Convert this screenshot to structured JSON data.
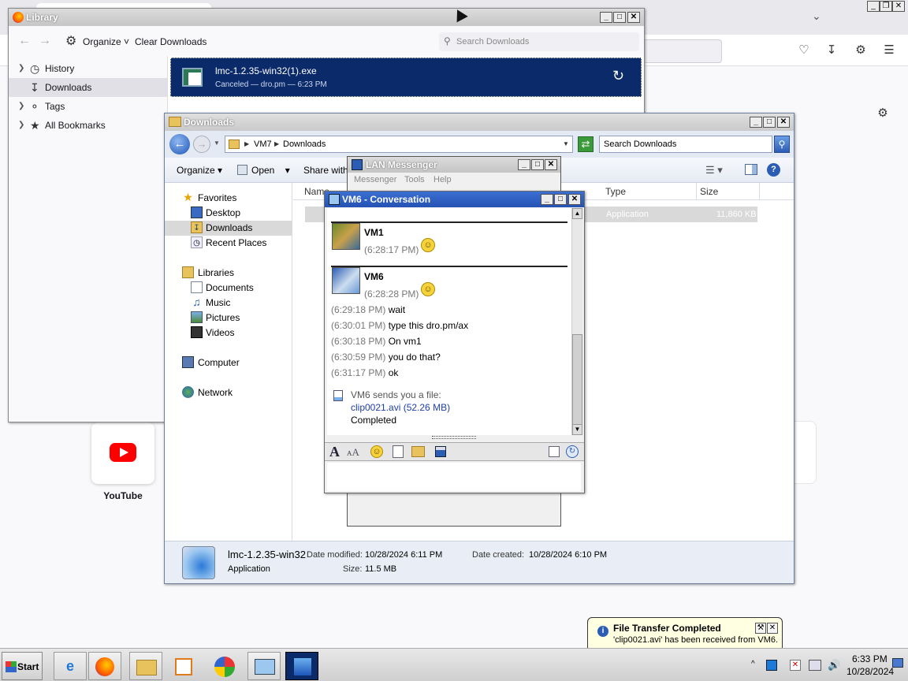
{
  "firefox": {
    "yt_label": "YouTube",
    "icons": [
      "pocket-icon",
      "download-icon",
      "extensions-icon",
      "menu-icon",
      "settings-icon"
    ]
  },
  "library": {
    "title": "Library",
    "organize": "Organize",
    "clear": "Clear Downloads",
    "search_placeholder": "Search Downloads",
    "sidebar": [
      {
        "label": "History",
        "icon": "clock-icon"
      },
      {
        "label": "Downloads",
        "icon": "download-icon"
      },
      {
        "label": "Tags",
        "icon": "tag-icon"
      },
      {
        "label": "All Bookmarks",
        "icon": "star-icon"
      }
    ],
    "download": {
      "name": "lmc-1.2.35-win32(1).exe",
      "status": "Canceled — dro.pm — 6:23 PM"
    }
  },
  "explorer": {
    "title": "Downloads",
    "breadcrumb": [
      "VM7",
      "Downloads"
    ],
    "search_placeholder": "Search Downloads",
    "cmd": {
      "organize": "Organize",
      "open": "Open",
      "share": "Share with"
    },
    "nav": {
      "favorites": "Favorites",
      "desktop": "Desktop",
      "downloads": "Downloads",
      "recent": "Recent Places",
      "libraries": "Libraries",
      "documents": "Documents",
      "music": "Music",
      "pictures": "Pictures",
      "videos": "Videos",
      "computer": "Computer",
      "network": "Network"
    },
    "columns": {
      "name": "Name",
      "type": "Type",
      "size": "Size"
    },
    "row": {
      "type": "Application",
      "size": "11,860 KB"
    },
    "details": {
      "name": "lmc-1.2.35-win32",
      "kind": "Application",
      "modified_label": "Date modified:",
      "modified": "10/28/2024 6:11 PM",
      "size_label": "Size:",
      "size": "11.5 MB",
      "created_label": "Date created:",
      "created": "10/28/2024 6:10 PM"
    }
  },
  "lan": {
    "title": "LAN Messenger",
    "menu": [
      "Messenger",
      "Tools",
      "Help"
    ]
  },
  "conversation": {
    "title": "VM6 - Conversation",
    "blocks": [
      {
        "sender": "VM1",
        "time": "(6:28:17 PM)"
      },
      {
        "sender": "VM6",
        "time": "(6:28:28 PM)"
      }
    ],
    "messages": [
      {
        "time": "(6:29:18 PM)",
        "text": "wait"
      },
      {
        "time": "(6:30:01 PM)",
        "text": "type this dro.pm/ax"
      },
      {
        "time": "(6:30:18 PM)",
        "text": "On vm1"
      },
      {
        "time": "(6:30:59 PM)",
        "text": "you do that?"
      },
      {
        "time": "(6:31:17 PM)",
        "text": "ok"
      }
    ],
    "file": {
      "intro": "VM6 sends you a file:",
      "link": "clip0021.avi (52.26 MB)",
      "status": "Completed"
    }
  },
  "notification": {
    "title": "File Transfer Completed",
    "body": "'clip0021.avi' has been received from VM6."
  },
  "taskbar": {
    "start": "Start",
    "time": "6:33 PM",
    "date": "10/28/2024"
  }
}
